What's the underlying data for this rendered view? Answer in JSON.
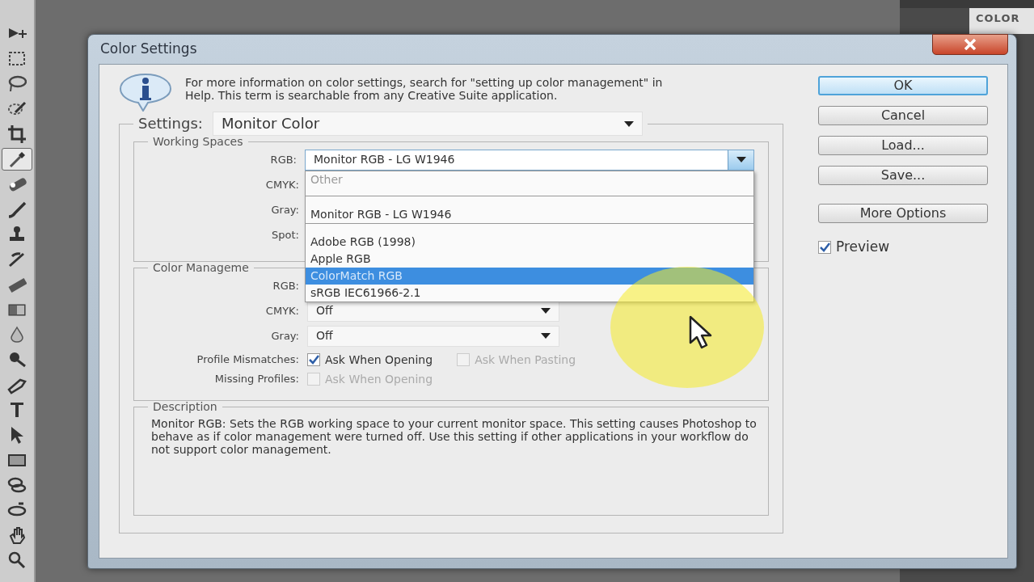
{
  "toolbar": {
    "tools": [
      {
        "kind": "move",
        "selected": false
      },
      {
        "kind": "marquee",
        "selected": false
      },
      {
        "kind": "lasso",
        "selected": false
      },
      {
        "kind": "quick_select",
        "selected": false
      },
      {
        "kind": "crop",
        "selected": false
      },
      {
        "kind": "eyedropper",
        "selected": true
      },
      {
        "kind": "healing",
        "selected": false
      },
      {
        "kind": "brush",
        "selected": false
      },
      {
        "kind": "stamp",
        "selected": false
      },
      {
        "kind": "history_brush",
        "selected": false
      },
      {
        "kind": "eraser",
        "selected": false
      },
      {
        "kind": "gradient",
        "selected": false
      },
      {
        "kind": "blur",
        "selected": false
      },
      {
        "kind": "dodge",
        "selected": false
      },
      {
        "kind": "pen",
        "selected": false
      },
      {
        "kind": "type",
        "selected": false
      },
      {
        "kind": "path_select",
        "selected": false
      },
      {
        "kind": "shape",
        "selected": false
      },
      {
        "kind": "rotate3d",
        "selected": false
      },
      {
        "kind": "orbit3d",
        "selected": false
      },
      {
        "kind": "hand",
        "selected": false
      },
      {
        "kind": "zoom",
        "selected": false
      }
    ]
  },
  "panel": {
    "tab": "COLOR"
  },
  "window": {
    "title": "Color Settings"
  },
  "info_text": "For more information on color settings, search for \"setting up color management\" in Help. This term is searchable from any Creative Suite application.",
  "settings": {
    "label": "Settings:",
    "value": "Monitor Color"
  },
  "working_spaces": {
    "title": "Working Spaces",
    "rows": [
      {
        "label": "RGB:",
        "value": "Monitor RGB - LG W1946",
        "open": true
      },
      {
        "label": "CMYK:"
      },
      {
        "label": "Gray:"
      },
      {
        "label": "Spot:"
      }
    ]
  },
  "dropdown": {
    "items": [
      {
        "kind": "header",
        "label": "Other"
      },
      {
        "kind": "separator"
      },
      {
        "kind": "option",
        "label": "Monitor RGB - LG W1946",
        "selected": false
      },
      {
        "kind": "separator"
      },
      {
        "kind": "option",
        "label": "Adobe RGB (1998)",
        "selected": false
      },
      {
        "kind": "option",
        "label": "Apple RGB",
        "selected": false
      },
      {
        "kind": "option",
        "label": "ColorMatch RGB",
        "selected": true
      },
      {
        "kind": "option",
        "label": "sRGB IEC61966-2.1",
        "selected": false
      }
    ]
  },
  "color_management": {
    "title": "Color Manageme",
    "rows": [
      {
        "label": "RGB:"
      },
      {
        "label": "CMYK:",
        "value": "Off"
      },
      {
        "label": "Gray:",
        "value": "Off"
      }
    ],
    "profile_mismatches": {
      "label": "Profile Mismatches:",
      "options": [
        {
          "label": "Ask When Opening",
          "checked": true,
          "disabled": false
        },
        {
          "label": "Ask When Pasting",
          "checked": false,
          "disabled": true
        }
      ]
    },
    "missing_profiles": {
      "label": "Missing Profiles:",
      "options": [
        {
          "label": "Ask When Opening",
          "checked": false,
          "disabled": true
        }
      ]
    }
  },
  "description": {
    "title": "Description",
    "text": "Monitor RGB:  Sets the RGB working space to your current monitor space. This setting causes Photoshop to behave as if color management were turned off.  Use this setting if other applications in your workflow do not support color management."
  },
  "buttons": [
    {
      "label": "OK",
      "default": true
    },
    {
      "label": "Cancel",
      "default": false
    },
    {
      "label": "Load...",
      "default": false
    },
    {
      "label": "Save...",
      "default": false
    },
    {
      "label": "More Options",
      "default": false
    }
  ],
  "preview": {
    "label": "Preview",
    "checked": true
  }
}
